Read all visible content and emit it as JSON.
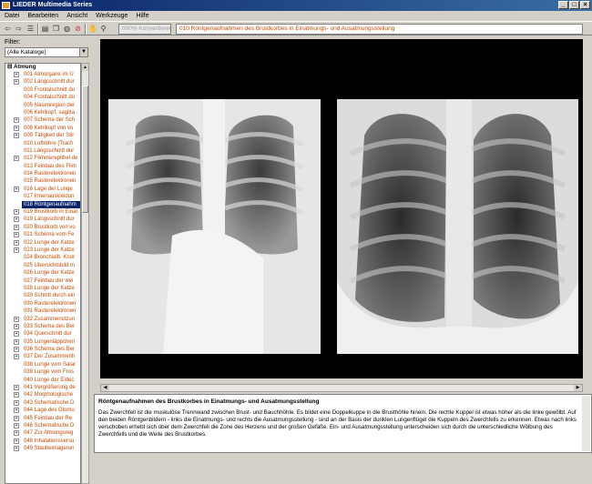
{
  "window": {
    "title": "LIEDER Multimedia Series",
    "min": "_",
    "max": "□",
    "close": "×"
  },
  "menu": [
    "Datei",
    "Bearbeiten",
    "Ansicht",
    "Werkzeuge",
    "Hilfe"
  ],
  "toolbar": {
    "search_placeholder": "000% Konvertieren",
    "current_title": "010 Röntgenaufnahmen des Brustkorbes in Einatmungs- und Ausatmungsstellung"
  },
  "filter": {
    "label": "Filter:",
    "value": "(Alle Kataloge)"
  },
  "tree": {
    "root": "Atmung",
    "items": [
      {
        "label": "001 Atmorgane im Ü",
        "exp": true
      },
      {
        "label": "002 Längsschnitt dur",
        "exp": true
      },
      {
        "label": "003 Frontalschnitt du",
        "exp": false
      },
      {
        "label": "004 Frontalschnitt du",
        "exp": false
      },
      {
        "label": "005 Nasenregion der",
        "exp": false
      },
      {
        "label": "006 Kehlkopf, sagitta",
        "exp": false
      },
      {
        "label": "007 Schema der Sch",
        "exp": true
      },
      {
        "label": "008 Kehlkopf von vo",
        "exp": true
      },
      {
        "label": "009 Tätigkeit der Stir",
        "exp": true
      },
      {
        "label": "010 Luftröhre (Trach",
        "exp": false
      },
      {
        "label": "011 Längsschnitt dur",
        "exp": false
      },
      {
        "label": "012 Flimmerepithel de",
        "exp": true
      },
      {
        "label": "013 Feinbau des Flim",
        "exp": false
      },
      {
        "label": "014 Rasterelektronen",
        "exp": false
      },
      {
        "label": "015 Rasterelektronen",
        "exp": false
      },
      {
        "label": "016 Lage der Lunge",
        "exp": true
      },
      {
        "label": "017 Innenauskleidun",
        "exp": false
      },
      {
        "label": "018 Röntgenaufnahm",
        "exp": false,
        "selected": true
      },
      {
        "label": "019 Brustkorb in Einat",
        "exp": true
      },
      {
        "label": "019 Längsschnitt dur",
        "exp": true
      },
      {
        "label": "020 Brustkorb von vo",
        "exp": true
      },
      {
        "label": "021 Schema vom Fe",
        "exp": true
      },
      {
        "label": "022 Lunge der Katze",
        "exp": true
      },
      {
        "label": "023 Lunge der Katze",
        "exp": true
      },
      {
        "label": "024 Bronchialb. Knor",
        "exp": false
      },
      {
        "label": "025 Übersichtsbild m",
        "exp": false
      },
      {
        "label": "026 Lunge der Katze",
        "exp": false
      },
      {
        "label": "027 Feinbau der wei",
        "exp": false
      },
      {
        "label": "028 Lunge der Katze",
        "exp": false
      },
      {
        "label": "029 Schnitt durch ein",
        "exp": false
      },
      {
        "label": "030 Rasterelektronen",
        "exp": false
      },
      {
        "label": "031 Rasterelektronen",
        "exp": false
      },
      {
        "label": "032 Zusammenstzun",
        "exp": true
      },
      {
        "label": "033 Schema des Ber",
        "exp": true
      },
      {
        "label": "034 Querschnitt dur",
        "exp": true
      },
      {
        "label": "035 Lungenläppchen",
        "exp": true
      },
      {
        "label": "036 Schema des Ber",
        "exp": true
      },
      {
        "label": "037 Der Zusammenh",
        "exp": true
      },
      {
        "label": "038 Lunge vom Salar",
        "exp": false
      },
      {
        "label": "039 Lunge vom Fros",
        "exp": false
      },
      {
        "label": "040 Lunge der Eidec",
        "exp": false
      },
      {
        "label": "041 Vergrößerung de",
        "exp": true
      },
      {
        "label": "042 Morphologische",
        "exp": true
      },
      {
        "label": "043 Schematische D",
        "exp": true
      },
      {
        "label": "044 Lage des Glomu",
        "exp": true
      },
      {
        "label": "045 Feinbau der Re",
        "exp": true
      },
      {
        "label": "046 Schematische D",
        "exp": true
      },
      {
        "label": "047 Zur Atmungsreg",
        "exp": true
      },
      {
        "label": "048 Inhalationsversu",
        "exp": true
      },
      {
        "label": "049 Staubeinlagerun",
        "exp": true
      }
    ]
  },
  "description": {
    "title": "Röntgenaufnahmen des Brustkorbes in Einatmungs- und Ausatmungsstellung",
    "text": "Das Zwerchfell ist die muskulöse Trennwand zwischen Brust- und Bauchhöhle. Es bildet eine Doppelkuppe in die Brusthöhle hinein. Die rechte Kuppel ist etwas höher als die linke gewölbt. Auf den beiden Röntgenbildern - links die Einatmungs- und rechts die Ausatmungsstellung - sind an der Basis der dunklen Lungenflügel die Kuppeln des Zwerchfells zu erkennen. Etwas nach links verschoben erhebt sich über dem Zwerchfell die Zone des Herzens und der großen Gefäße. Ein- und Ausatmungsstellung unterscheiden sich durch die unterschiedliche Wölbung des Zwerchfells und die Weite des Brustkorbes."
  }
}
